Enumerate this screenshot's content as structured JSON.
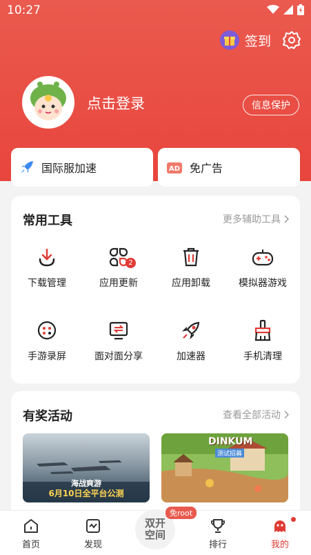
{
  "status": {
    "time": "10:27"
  },
  "header": {
    "signin_label": "签到",
    "login_label": "点击登录",
    "privacy_label": "信息保护"
  },
  "quick": [
    {
      "label": "国际服加速",
      "icon": "rocket-icon"
    },
    {
      "label": "免广告",
      "icon": "ad-icon"
    }
  ],
  "tools": {
    "title": "常用工具",
    "more": "更多辅助工具",
    "badge": "2",
    "items": [
      {
        "label": "下载管理",
        "icon": "download-icon"
      },
      {
        "label": "应用更新",
        "icon": "update-icon"
      },
      {
        "label": "应用卸载",
        "icon": "trash-icon"
      },
      {
        "label": "模拟器游戏",
        "icon": "gamepad-icon"
      },
      {
        "label": "手游录屏",
        "icon": "record-icon"
      },
      {
        "label": "面对面分享",
        "icon": "share-icon"
      },
      {
        "label": "加速器",
        "icon": "rocket-icon"
      },
      {
        "label": "手机清理",
        "icon": "broom-icon"
      }
    ]
  },
  "events": {
    "title": "有奖活动",
    "more": "查看全部活动",
    "banner1": {
      "line1": "海战爽游",
      "line2": "6月10日全平台公测"
    },
    "banner2": {
      "title": "DINKUM",
      "subtitle": "测试招募"
    }
  },
  "nav": {
    "items": [
      {
        "label": "首页",
        "icon": "home-icon"
      },
      {
        "label": "发现",
        "icon": "discover-icon"
      },
      {
        "label": "排行",
        "icon": "trophy-icon"
      },
      {
        "label": "我的",
        "icon": "mine-icon"
      }
    ],
    "center_line1": "双开",
    "center_line2": "空间",
    "center_badge": "免root"
  },
  "colors": {
    "brand": "#e8453d",
    "accent_red": "#e03b35"
  }
}
